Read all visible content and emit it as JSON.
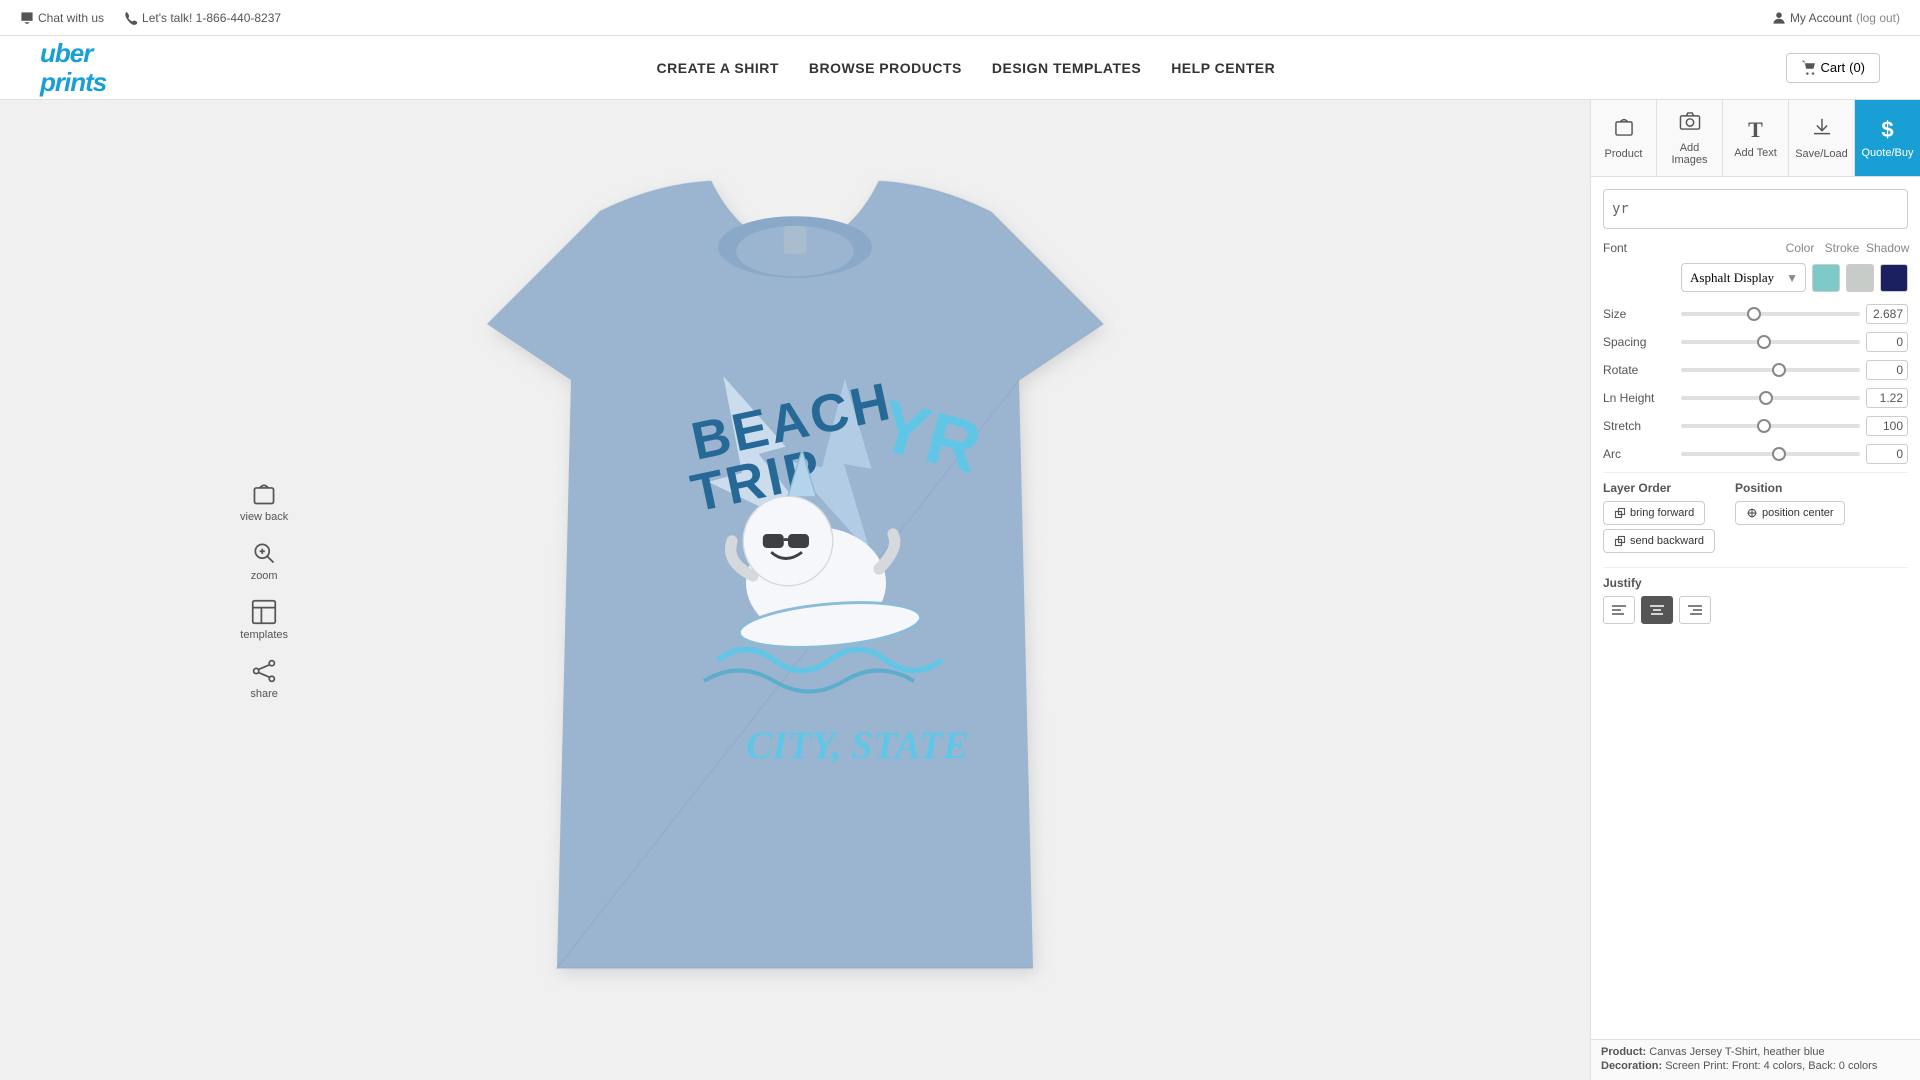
{
  "topbar": {
    "chat_label": "Chat with us",
    "phone_label": "Let's talk! 1-866-440-8237",
    "account_label": "My Account",
    "logout_label": "(log out)"
  },
  "header": {
    "logo_line1": "uber",
    "logo_line2": "prints",
    "nav": [
      {
        "label": "CREATE A SHIRT",
        "id": "create"
      },
      {
        "label": "BROWSE PRODUCTS",
        "id": "browse"
      },
      {
        "label": "DESIGN TEMPLATES",
        "id": "templates"
      },
      {
        "label": "HELP CENTER",
        "id": "help"
      }
    ],
    "cart_label": "Cart",
    "cart_count": "(0)"
  },
  "toolbar_tabs": [
    {
      "label": "Product",
      "icon": "👕",
      "id": "product"
    },
    {
      "label": "Add Images",
      "icon": "📷",
      "id": "add-images"
    },
    {
      "label": "Add Text",
      "icon": "T",
      "id": "add-text"
    },
    {
      "label": "Save/Load",
      "icon": "⬇",
      "id": "save-load"
    },
    {
      "label": "Quote/Buy",
      "icon": "$",
      "id": "quote-buy",
      "active": true
    }
  ],
  "text_editor": {
    "text_value": "yr",
    "font_label": "Font",
    "color_label": "Color",
    "stroke_label": "Stroke",
    "shadow_label": "Shadow",
    "font_selected": "Asphalt Display",
    "color_swatch": "#7ecac8",
    "stroke_swatch": "#c8ccc8",
    "shadow_swatch": "#1a2060",
    "sliders": [
      {
        "label": "Size",
        "value": "2.687",
        "percent": 40
      },
      {
        "label": "Spacing",
        "value": "0",
        "percent": 46
      },
      {
        "label": "Rotate",
        "value": "0",
        "percent": 55
      },
      {
        "label": "Ln Height",
        "value": "1.22",
        "percent": 47
      },
      {
        "label": "Stretch",
        "value": "100",
        "percent": 46
      },
      {
        "label": "Arc",
        "value": "0",
        "percent": 55
      }
    ],
    "layer_order": {
      "label": "Layer Order",
      "bring_forward": "bring forward",
      "send_backward": "send backward"
    },
    "position": {
      "label": "Position",
      "center_btn": "position center"
    },
    "justify": {
      "label": "Justify",
      "options": [
        "left",
        "center",
        "right"
      ]
    }
  },
  "side_tools": [
    {
      "label": "view back",
      "icon": "👕",
      "id": "view-back"
    },
    {
      "label": "zoom",
      "icon": "🔍",
      "id": "zoom"
    },
    {
      "label": "templates",
      "icon": "🖼",
      "id": "templates"
    },
    {
      "label": "share",
      "icon": "↗",
      "id": "share"
    }
  ],
  "status": {
    "product_label": "Product:",
    "product_value": "Canvas Jersey T-Shirt, heather blue",
    "decoration_label": "Decoration:",
    "decoration_value": "Screen Print: Front: 4 colors, Back: 0 colors"
  }
}
